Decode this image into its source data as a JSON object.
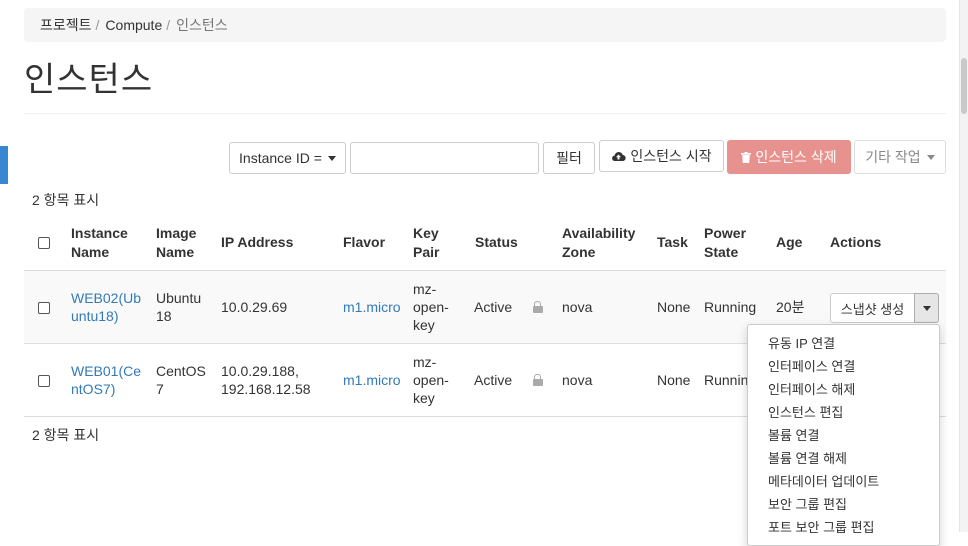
{
  "breadcrumb": {
    "items": [
      "프로젝트",
      "Compute",
      "인스턴스"
    ]
  },
  "page": {
    "title": "인스턴스"
  },
  "toolbar": {
    "filter_select": "Instance ID =",
    "filter_input_value": "",
    "filter_button": "필터",
    "launch_button": "인스턴스 시작",
    "delete_button": "인스턴스 삭제",
    "more_button": "기타 작업"
  },
  "table": {
    "count_label": "2 항목 표시",
    "headers": {
      "instance_name": [
        "Instance",
        "Name"
      ],
      "image_name": [
        "Image",
        "Name"
      ],
      "ip": "IP Address",
      "flavor": "Flavor",
      "key_pair": [
        "Key",
        "Pair"
      ],
      "status": "Status",
      "az": [
        "Availability",
        "Zone"
      ],
      "task": "Task",
      "power": [
        "Power",
        "State"
      ],
      "age": "Age",
      "actions": "Actions"
    },
    "rows": [
      {
        "name": [
          "WEB02(Ub",
          "untu18)"
        ],
        "image": [
          "Ubuntu",
          "18"
        ],
        "ip": [
          "10.0.29.69"
        ],
        "flavor": "m1.micro",
        "key_pair": [
          "mz-",
          "open-",
          "key"
        ],
        "status": "Active",
        "az": "nova",
        "task": "None",
        "power": "Running",
        "age": "20분",
        "action_label": "스냅샷 생성"
      },
      {
        "name": [
          "WEB01(Ce",
          "ntOS7)"
        ],
        "image": [
          "CentOS",
          "7"
        ],
        "ip": [
          "10.0.29.188,",
          "192.168.12.58"
        ],
        "flavor": "m1.micro",
        "key_pair": [
          "mz-",
          "open-",
          "key"
        ],
        "status": "Active",
        "az": "nova",
        "task": "None",
        "power": "Running"
      }
    ]
  },
  "actions_menu": {
    "items": [
      "유동 IP 연결",
      "인터페이스 연결",
      "인터페이스 해제",
      "인스턴스 편집",
      "볼륨 연결",
      "볼륨 연결 해제",
      "메타데이터 업데이트",
      "보안 그룹 편집",
      "포트 보안 그룹 편집"
    ]
  },
  "colors": {
    "link": "#337ab7",
    "danger": "#e8928f",
    "accent": "#3a87d1"
  }
}
